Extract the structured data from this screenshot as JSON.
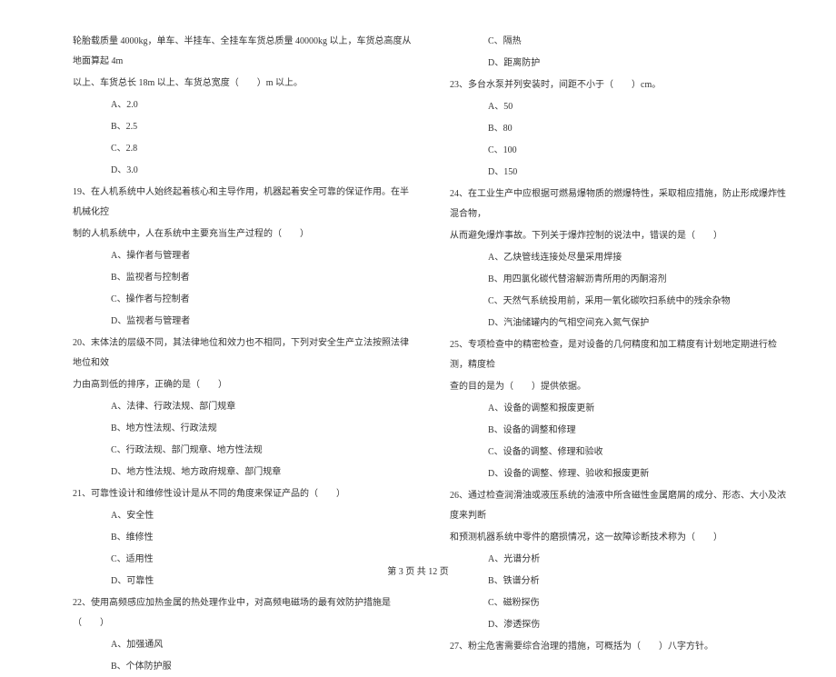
{
  "left_column": {
    "q18_cont1": "轮胎载质量 4000kg，单车、半挂车、全挂车车货总质量 40000kg 以上，车货总高度从地面算起 4m",
    "q18_cont2": "以上、车货总长 18m 以上、车货总宽度（　　）m 以上。",
    "q18_opts": [
      "A、2.0",
      "B、2.5",
      "C、2.8",
      "D、3.0"
    ],
    "q19_text1": "19、在人机系统中人始终起着核心和主导作用，机器起着安全可靠的保证作用。在半机械化控",
    "q19_text2": "制的人机系统中，人在系统中主要充当生产过程的（　　）",
    "q19_opts": [
      "A、操作者与管理者",
      "B、监视者与控制者",
      "C、操作者与控制者",
      "D、监视者与管理者"
    ],
    "q20_text1": "20、末体法的层级不同，其法律地位和效力也不相同，下列对安全生产立法按照法律地位和效",
    "q20_text2": "力由高到低的排序，正确的是（　　）",
    "q20_opts": [
      "A、法律、行政法规、部门规章",
      "B、地方性法规、行政法规",
      "C、行政法规、部门规章、地方性法规",
      "D、地方性法规、地方政府规章、部门规章"
    ],
    "q21_text": "21、可靠性设计和维修性设计是从不同的角度来保证产品的（　　）",
    "q21_opts": [
      "A、安全性",
      "B、维修性",
      "C、适用性",
      "D、可靠性"
    ],
    "q22_text": "22、使用高频感应加热金属的热处理作业中，对高频电磁场的最有效防护措施是（　　）",
    "q22_opts": [
      "A、加强通风",
      "B、个体防护服"
    ]
  },
  "right_column": {
    "q22_opts_cont": [
      "C、隔热",
      "D、距离防护"
    ],
    "q23_text": "23、多台水泵并列安装时，间距不小于（　　）cm。",
    "q23_opts": [
      "A、50",
      "B、80",
      "C、100",
      "D、150"
    ],
    "q24_text1": "24、在工业生产中应根据可燃易爆物质的燃爆特性，采取相应措施，防止形成爆炸性混合物，",
    "q24_text2": "从而避免爆炸事故。下列关于爆炸控制的说法中，错误的是（　　）",
    "q24_opts": [
      "A、乙炔管线连接处尽量采用焊接",
      "B、用四氯化碳代替溶解沥青所用的丙酮溶剂",
      "C、天然气系统投用前，采用一氧化碳吹扫系统中的残余杂物",
      "D、汽油储罐内的气相空间充入氮气保护"
    ],
    "q25_text1": "25、专项检查中的精密检查，是对设备的几何精度和加工精度有计划地定期进行检测，精度检",
    "q25_text2": "查的目的是为（　　）提供依据。",
    "q25_opts": [
      "A、设备的调整和报废更新",
      "B、设备的调整和修理",
      "C、设备的调整、修理和验收",
      "D、设备的调整、修理、验收和报废更新"
    ],
    "q26_text1": "26、通过检查润滑油或液压系统的油液中所含磁性金属磨屑的成分、形态、大小及浓度来判断",
    "q26_text2": "和预测机器系统中零件的磨损情况，这一故障诊断技术称为（　　）",
    "q26_opts": [
      "A、光谱分析",
      "B、铁谱分析",
      "C、磁粉探伤",
      "D、渗透探伤"
    ],
    "q27_text": "27、粉尘危害需要综合治理的措施，可概括为（　　）八字方针。"
  },
  "footer": "第 3 页 共 12 页"
}
